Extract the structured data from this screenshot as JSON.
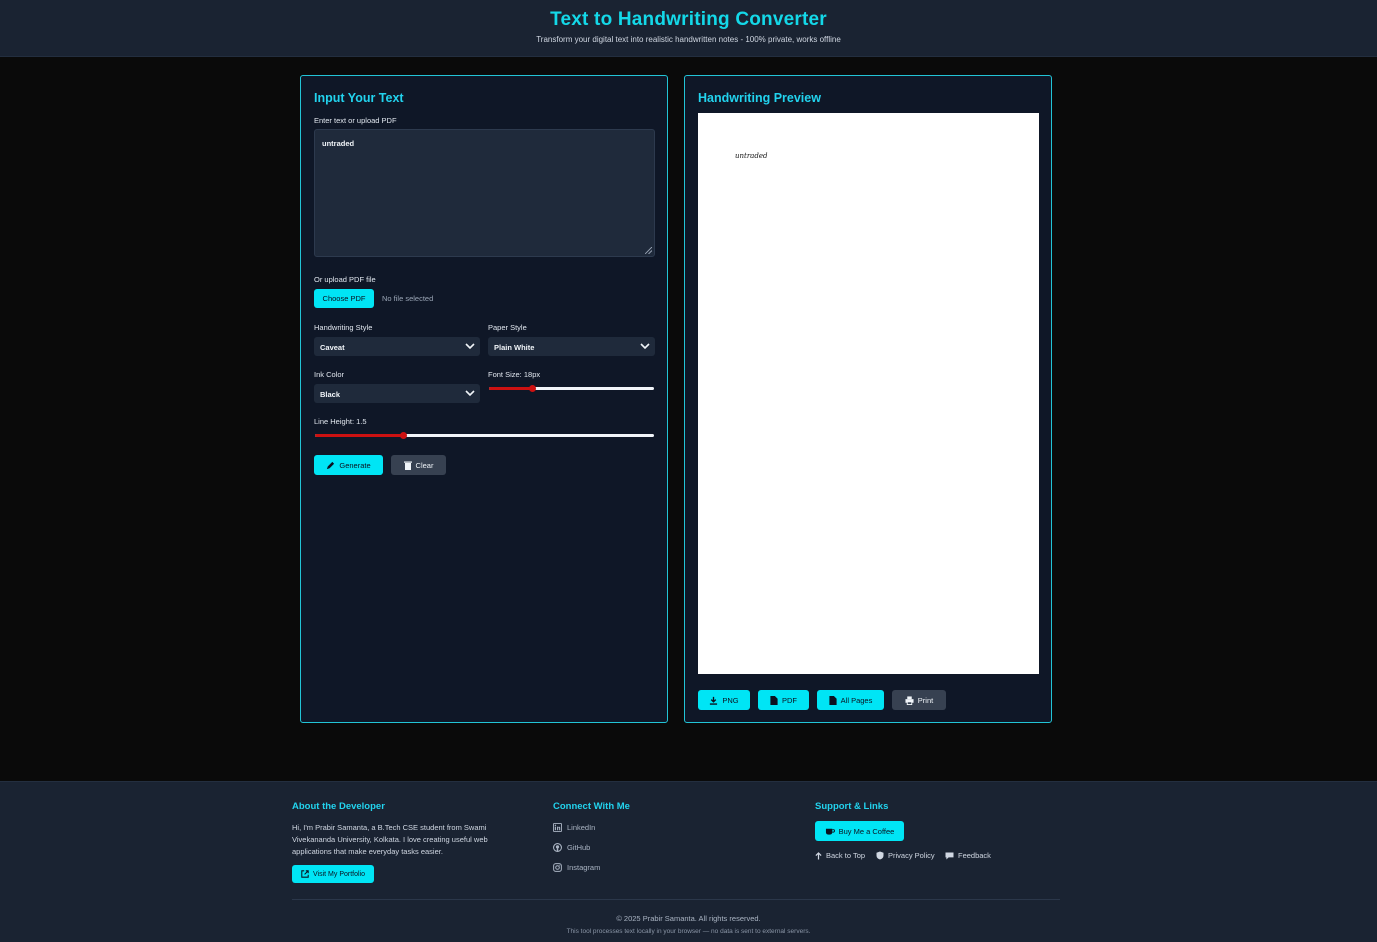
{
  "header": {
    "title": "Text to Handwriting Converter",
    "subtitle": "Transform your digital text into realistic handwritten notes - 100% private, works offline"
  },
  "input_panel": {
    "title": "Input Your Text",
    "text_label": "Enter text or upload PDF",
    "text_value": "untraded",
    "upload_label": "Or upload PDF file",
    "choose_pdf_label": "Choose PDF",
    "no_file_text": "No file selected",
    "handwriting_style_label": "Handwriting Style",
    "handwriting_style_value": "Caveat",
    "paper_style_label": "Paper Style",
    "paper_style_value": "Plain White",
    "ink_color_label": "Ink Color",
    "ink_color_value": "Black",
    "font_size_label": "Font Size: 18px",
    "font_size_fraction": 0.26,
    "line_height_label": "Line Height: 1.5",
    "line_height_fraction": 0.26,
    "generate_label": "Generate",
    "clear_label": "Clear"
  },
  "preview_panel": {
    "title": "Handwriting Preview",
    "handwritten_text": "untraded",
    "png_label": "PNG",
    "pdf_label": "PDF",
    "all_pages_label": "All Pages",
    "print_label": "Print"
  },
  "footer": {
    "about_title": "About the Developer",
    "about_text": "Hi, I'm Prabir Samanta, a B.Tech CSE student from Swami Vivekananda University, Kolkata. I love creating useful web applications that make everyday tasks easier.",
    "portfolio_label": "Visit My Portfolio",
    "connect_title": "Connect With Me",
    "linkedin_label": "LinkedIn",
    "github_label": "GitHub",
    "instagram_label": "Instagram",
    "support_title": "Support & Links",
    "coffee_label": "Buy Me a Coffee",
    "back_to_top_label": "Back to Top",
    "privacy_label": "Privacy Policy",
    "feedback_label": "Feedback",
    "copyright": "© 2025 Prabir Samanta. All rights reserved.",
    "privacy_note": "This tool processes text locally in your browser — no data is sent to external servers."
  },
  "colors": {
    "accent": "#00e5f5",
    "slider_fill": "#cc1111",
    "panel_border": "#22c4d6"
  }
}
